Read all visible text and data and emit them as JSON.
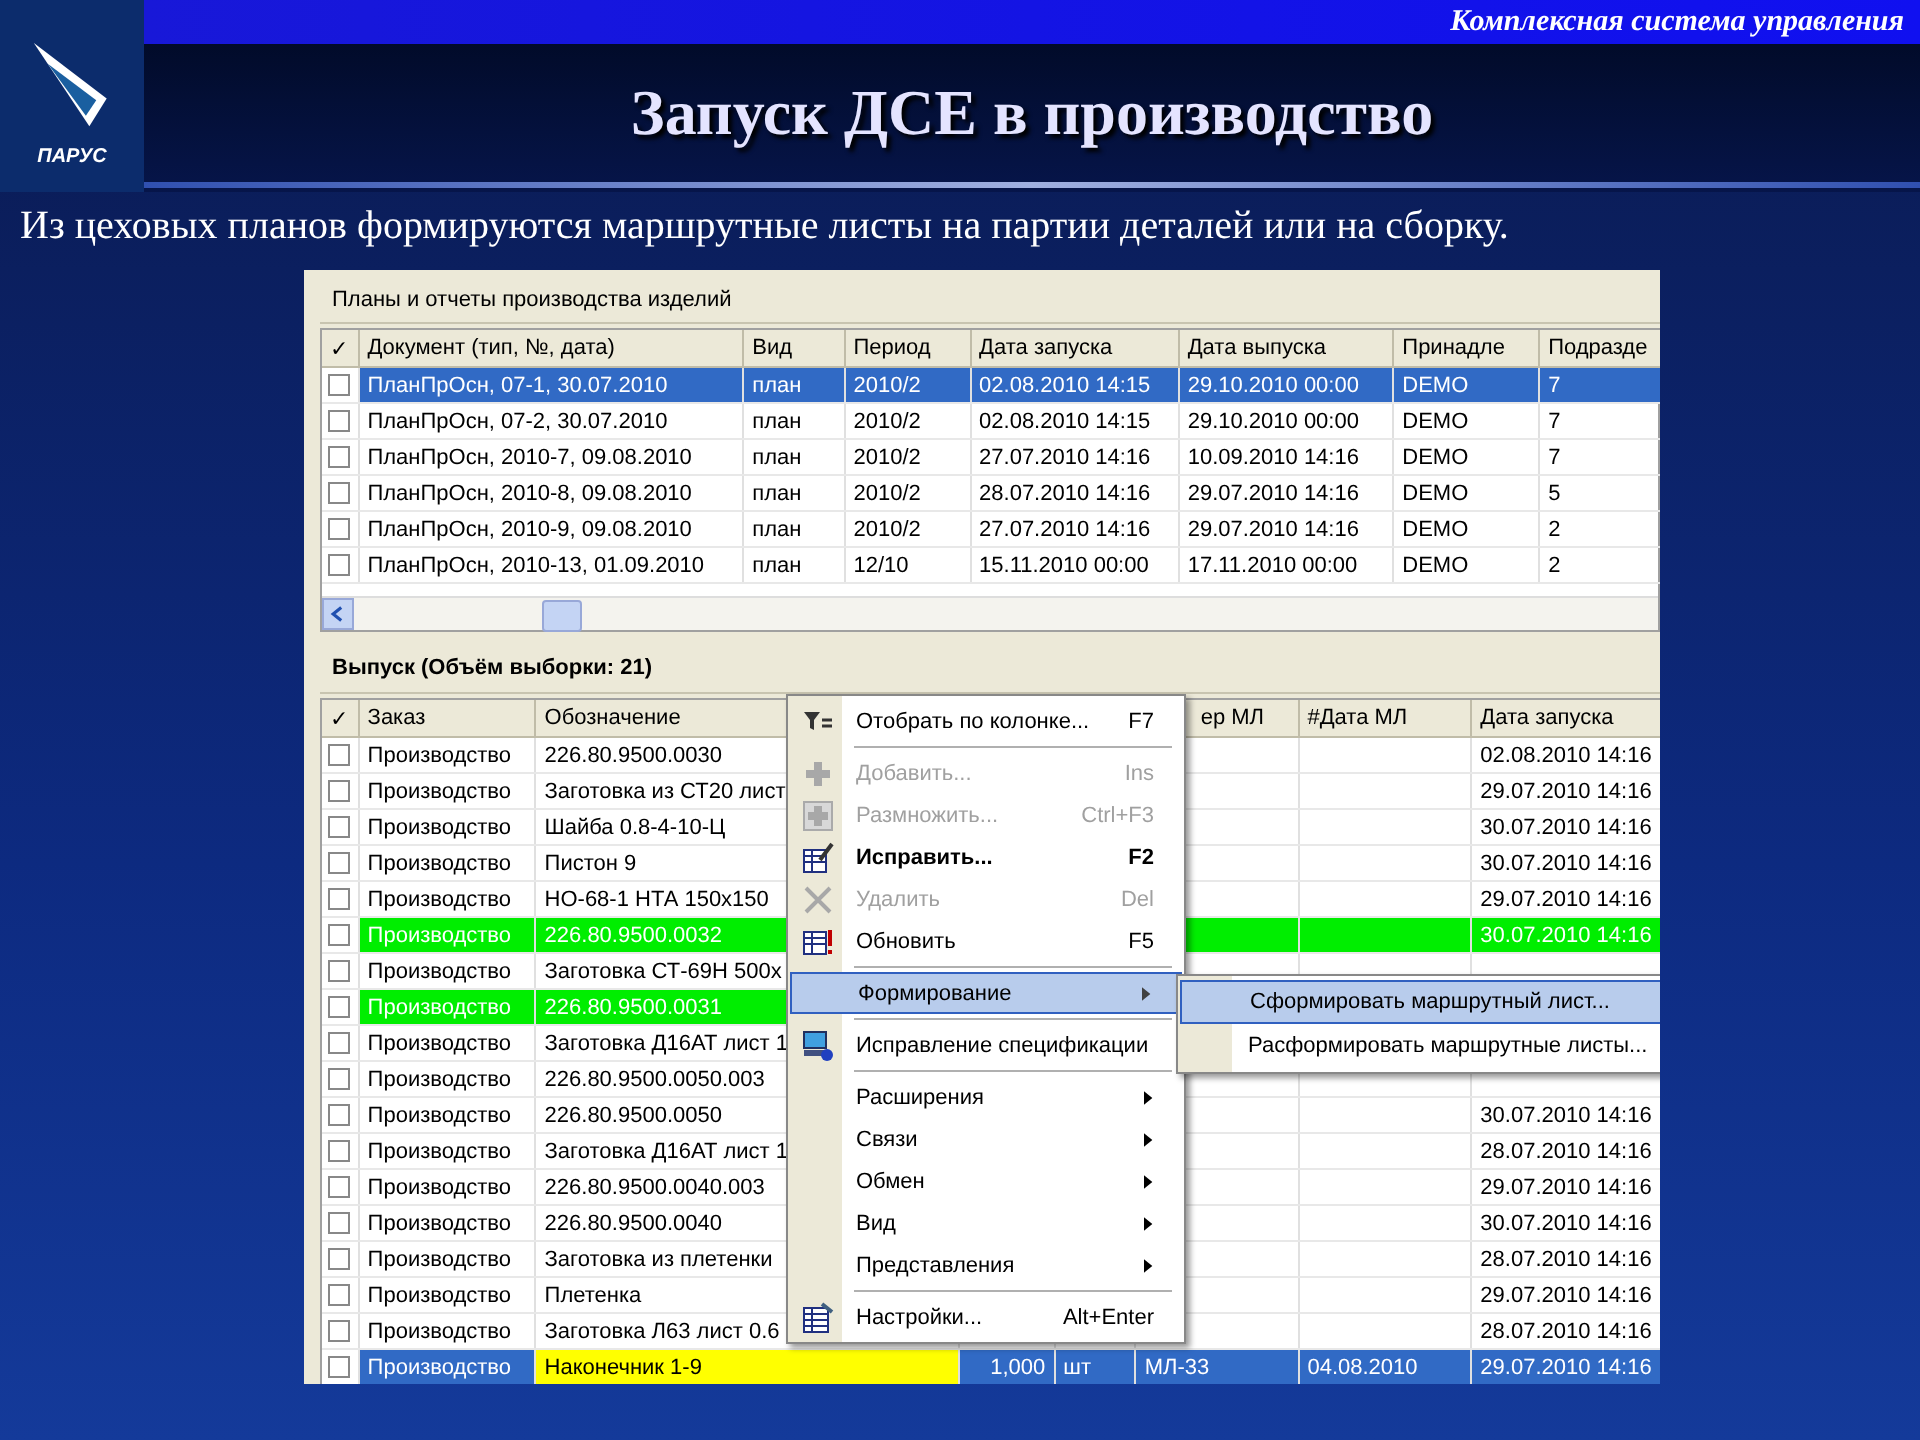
{
  "header": {
    "tagline": "Комплексная система управления",
    "title": "Запуск ДСЕ в производство",
    "logo_text": "ПАРУС"
  },
  "subtitle": "Из цеховых планов формируются маршрутные листы на партии деталей или на сборку.",
  "plans_panel": {
    "title": "Планы и отчеты производства изделий",
    "columns": [
      "✓",
      "Документ (тип, №, дата)",
      "Вид",
      "Период",
      "Дата запуска",
      "Дата выпуска",
      "Принадле",
      "Подразде"
    ],
    "rows": [
      {
        "checked": false,
        "selected": true,
        "document": "ПланПрОсн, 07-1, 30.07.2010",
        "kind": "план",
        "period": "2010/2",
        "launch": "02.08.2010 14:15",
        "release": "29.10.2010 00:00",
        "owner": "DEMO",
        "division": "7"
      },
      {
        "checked": false,
        "selected": false,
        "document": "ПланПрОсн, 07-2, 30.07.2010",
        "kind": "план",
        "period": "2010/2",
        "launch": "02.08.2010 14:15",
        "release": "29.10.2010 00:00",
        "owner": "DEMO",
        "division": "7"
      },
      {
        "checked": false,
        "selected": false,
        "document": "ПланПрОсн, 2010-7, 09.08.2010",
        "kind": "план",
        "period": "2010/2",
        "launch": "27.07.2010 14:16",
        "release": "10.09.2010 14:16",
        "owner": "DEMO",
        "division": "7"
      },
      {
        "checked": false,
        "selected": false,
        "document": "ПланПрОсн, 2010-8, 09.08.2010",
        "kind": "план",
        "period": "2010/2",
        "launch": "28.07.2010 14:16",
        "release": "29.07.2010 14:16",
        "owner": "DEMO",
        "division": "5"
      },
      {
        "checked": false,
        "selected": false,
        "document": "ПланПрОсн, 2010-9, 09.08.2010",
        "kind": "план",
        "period": "2010/2",
        "launch": "27.07.2010 14:16",
        "release": "29.07.2010 14:16",
        "owner": "DEMO",
        "division": "2"
      },
      {
        "checked": false,
        "selected": false,
        "document": "ПланПрОсн, 2010-13, 01.09.2010",
        "kind": "план",
        "period": "12/10",
        "launch": "15.11.2010 00:00",
        "release": "17.11.2010 00:00",
        "owner": "DEMO",
        "division": "2"
      }
    ]
  },
  "output_panel": {
    "title": "Выпуск (Объём выборки: 21)",
    "columns": [
      "✓",
      "Заказ",
      "Обозначение",
      "ер МЛ",
      "#Дата МЛ",
      "Дата запуска"
    ],
    "rows": [
      {
        "checked": false,
        "selected": false,
        "order": "Производство",
        "designation": "226.80.9500.0030",
        "launch": "02.08.2010 14:16"
      },
      {
        "checked": false,
        "selected": false,
        "order": "Производство",
        "designation": "Заготовка из СТ20 лист",
        "launch": "29.07.2010 14:16"
      },
      {
        "checked": false,
        "selected": false,
        "order": "Производство",
        "designation": "Шайба 0.8-4-10-Ц",
        "launch": "30.07.2010 14:16"
      },
      {
        "checked": false,
        "selected": false,
        "order": "Производство",
        "designation": "Пистон 9",
        "launch": "30.07.2010 14:16"
      },
      {
        "checked": false,
        "selected": false,
        "order": "Производство",
        "designation": "НО-68-1 НТА 150х150",
        "launch": "29.07.2010 14:16"
      },
      {
        "checked": false,
        "selected": false,
        "color": "#00ee00",
        "order": "Производство",
        "designation": "226.80.9500.0032",
        "launch": "30.07.2010 14:16"
      },
      {
        "checked": false,
        "selected": false,
        "order": "Производство",
        "designation": "Заготовка СТ-69Н 500х"
      },
      {
        "checked": false,
        "selected": false,
        "color": "#00ee00",
        "order": "Производство",
        "designation": "226.80.9500.0031"
      },
      {
        "checked": false,
        "selected": false,
        "order": "Производство",
        "designation": "Заготовка Д16АТ лист 1"
      },
      {
        "checked": false,
        "selected": false,
        "order": "Производство",
        "designation": "226.80.9500.0050.003"
      },
      {
        "checked": false,
        "selected": false,
        "order": "Производство",
        "designation": "226.80.9500.0050",
        "launch": "30.07.2010 14:16"
      },
      {
        "checked": false,
        "selected": false,
        "order": "Производство",
        "designation": "Заготовка Д16АТ лист 1",
        "launch": "28.07.2010 14:16"
      },
      {
        "checked": false,
        "selected": false,
        "order": "Производство",
        "designation": "226.80.9500.0040.003",
        "launch": "29.07.2010 14:16"
      },
      {
        "checked": false,
        "selected": false,
        "order": "Производство",
        "designation": "226.80.9500.0040",
        "launch": "30.07.2010 14:16"
      },
      {
        "checked": false,
        "selected": false,
        "order": "Производство",
        "designation": "Заготовка из плетенки",
        "launch": "28.07.2010 14:16"
      },
      {
        "checked": false,
        "selected": false,
        "order": "Производство",
        "designation": "Плетенка",
        "launch": "29.07.2010 14:16"
      },
      {
        "checked": false,
        "selected": false,
        "order": "Производство",
        "designation": "Заготовка Л63 лист 0.6",
        "launch": "28.07.2010 14:16"
      },
      {
        "checked": false,
        "selected": true,
        "color": "#ffff00",
        "order": "Производство",
        "designation": "Наконечник 1-9",
        "quantity": "1,000",
        "unit": "шт",
        "route_sheet": "МЛ-33",
        "route_sheet_date": "04.08.2010",
        "launch": "29.07.2010 14:16"
      }
    ]
  },
  "context_menu": {
    "items": [
      {
        "kind": "item",
        "label": "Отобрать по колонке...",
        "shortcut": "F7",
        "disabled": false,
        "default": false,
        "selected": false
      },
      {
        "kind": "separator"
      },
      {
        "kind": "item",
        "label": "Добавить...",
        "shortcut": "Ins",
        "disabled": true,
        "default": false,
        "selected": false
      },
      {
        "kind": "item",
        "label": "Размножить...",
        "shortcut": "Ctrl+F3",
        "disabled": true,
        "default": false,
        "selected": false
      },
      {
        "kind": "item",
        "label": "Исправить...",
        "shortcut": "F2",
        "disabled": false,
        "default": true,
        "selected": false
      },
      {
        "kind": "item",
        "label": "Удалить",
        "shortcut": "Del",
        "disabled": true,
        "default": false,
        "selected": false
      },
      {
        "kind": "item",
        "label": "Обновить",
        "shortcut": "F5",
        "disabled": false,
        "default": false,
        "selected": false
      },
      {
        "kind": "separator"
      },
      {
        "kind": "item",
        "label": "Формирование",
        "disabled": false,
        "default": false,
        "selected": true,
        "submenu": true
      },
      {
        "kind": "separator"
      },
      {
        "kind": "item",
        "label": "Исправление спецификации",
        "disabled": false,
        "default": false,
        "selected": false
      },
      {
        "kind": "separator"
      },
      {
        "kind": "item",
        "label": "Расширения",
        "disabled": false,
        "default": false,
        "selected": false,
        "submenu": true
      },
      {
        "kind": "item",
        "label": "Связи",
        "disabled": false,
        "default": false,
        "selected": false,
        "submenu": true
      },
      {
        "kind": "item",
        "label": "Обмен",
        "disabled": false,
        "default": false,
        "selected": false,
        "submenu": true
      },
      {
        "kind": "item",
        "label": "Вид",
        "disabled": false,
        "default": false,
        "selected": false,
        "submenu": true
      },
      {
        "kind": "item",
        "label": "Представления",
        "disabled": false,
        "default": false,
        "selected": false,
        "submenu": true
      },
      {
        "kind": "separator"
      },
      {
        "kind": "item",
        "label": "Настройки...",
        "shortcut": "Alt+Enter",
        "disabled": false,
        "default": false,
        "selected": false
      }
    ]
  },
  "submenu": {
    "items": [
      {
        "label": "Сформировать маршрутный лист...",
        "selected": true
      },
      {
        "label": "Расформировать маршрутные листы...",
        "selected": false
      }
    ]
  }
}
